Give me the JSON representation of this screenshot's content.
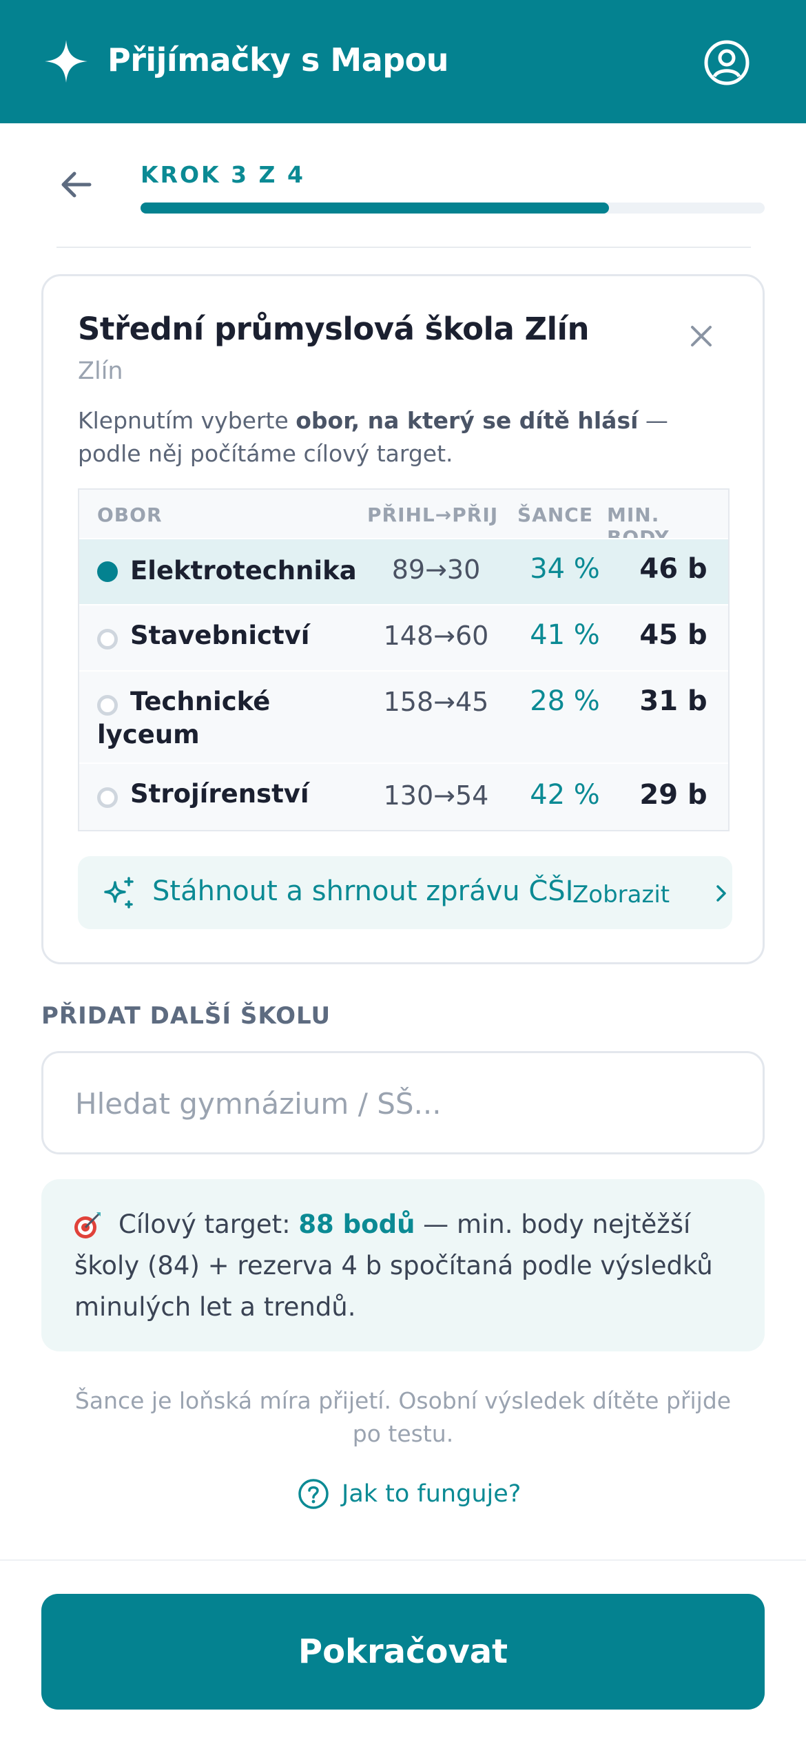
{
  "header": {
    "app_title": "Přijímačky s Mapou",
    "logo_icon": "sparkle-icon",
    "account_icon": "user-circle-icon",
    "background_color": "#048290"
  },
  "stepper": {
    "label": "KROK 3 Z 4",
    "current_step": 3,
    "total_steps": 4,
    "progress_fraction": 0.75
  },
  "school_card": {
    "name": "Střední průmyslová škola Zlín",
    "city": "Zlín",
    "instruction_pre": "Klepnutím vyberte ",
    "instruction_bold": "obor, na který se dítě hlásí",
    "instruction_post": " — podle něj počítáme cílový target.",
    "table": {
      "headers": {
        "program": "OBOR",
        "applicants": "PŘIHL→PŘIJ",
        "chance": "ŠANCE",
        "min_points": "MIN. BODY"
      },
      "rows": [
        {
          "name": "Elektrotechnika",
          "applicants": "89→30",
          "chance": "34 %",
          "min_points": "46 b",
          "selected": true
        },
        {
          "name": "Stavebnictví",
          "applicants": "148→60",
          "chance": "41 %",
          "min_points": "45 b",
          "selected": false
        },
        {
          "name": "Technické lyceum",
          "applicants": "158→45",
          "chance": "28 %",
          "min_points": "31 b",
          "selected": false
        },
        {
          "name": "Strojírenství",
          "applicants": "130→54",
          "chance": "42 %",
          "min_points": "29 b",
          "selected": false
        }
      ]
    },
    "csi": {
      "label": "Stáhnout a shrnout zprávu ČŠI",
      "link": "Zobrazit"
    }
  },
  "add_school": {
    "label": "PŘIDAT DALŠÍ ŠKOLU",
    "placeholder": "Hledat gymnázium / SŠ...",
    "value": ""
  },
  "target": {
    "prefix": "Cílový target: ",
    "points": "88 bodů",
    "suffix": " — min. body nejtěžší školy (84) + rezerva 4 b spočítaná podle výsledků minulých let a trendů."
  },
  "footnote": "Šance je loňská míra přijetí. Osobní výsledek dítěte přijde po testu.",
  "help_link": "Jak to funguje?",
  "continue_button": "Pokračovat",
  "accent_color": "#0b8a94"
}
